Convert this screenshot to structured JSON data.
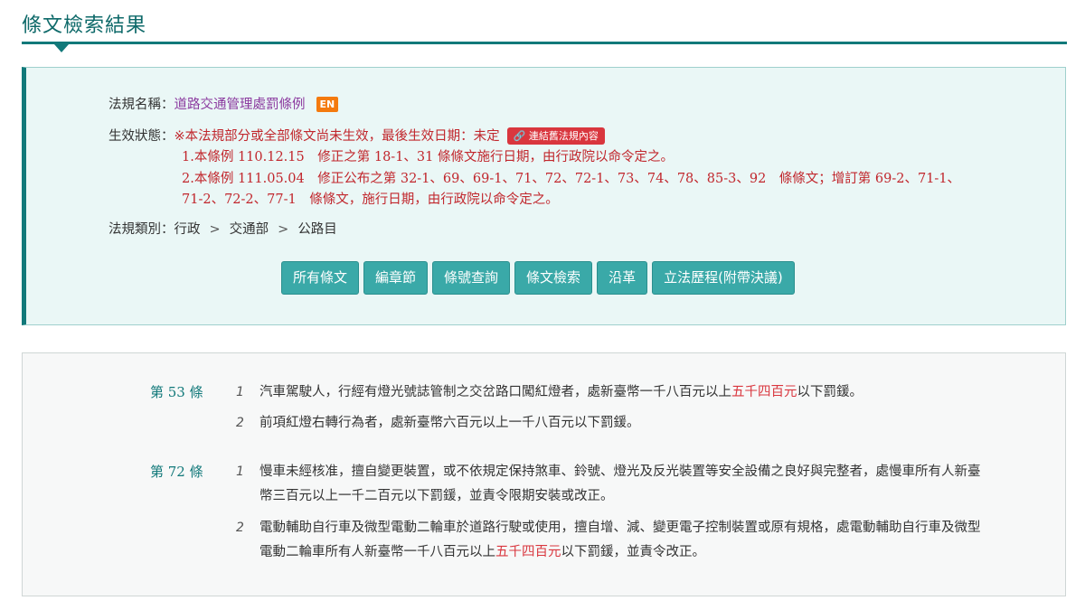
{
  "header": {
    "title": "條文檢索結果"
  },
  "info": {
    "name_label": "法規名稱：",
    "law_name": "道路交通管理處罰條例",
    "en_badge": "EN",
    "status_label": "生效狀態：",
    "status_text": "※本法規部分或全部條文尚未生效，最後生效日期：未定",
    "old_link_label": "🔗 連結舊法規內容",
    "status_note_1": "1.本條例 110.12.15　修正之第 18-1、31 條條文施行日期，由行政院以命令定之。",
    "status_note_2": "2.本條例 111.05.04　修正公布之第 32-1、69、69-1、71、72、72-1、73、74、78、85-3、92　條條文；增訂第 69-2、71-1、71-2、72-2、77-1　條條文，施行日期，由行政院以命令定之。",
    "category_label": "法規類別：",
    "category_path": [
      "行政",
      "交通部",
      "公路目"
    ],
    "category_sep": ">"
  },
  "buttons": [
    "所有條文",
    "編章節",
    "條號查詢",
    "條文檢索",
    "沿革",
    "立法歷程(附帶決議)"
  ],
  "articles": [
    {
      "number": "第 53 條",
      "paragraphs": [
        {
          "idx": "1",
          "before": "汽車駕駛人，行經有燈光號誌管制之交岔路口闖紅燈者，處新臺幣一千八百元以上",
          "highlight": "五千四百元",
          "after": "以下罰鍰。"
        },
        {
          "idx": "2",
          "before": "前項紅燈右轉行為者，處新臺幣六百元以上一千八百元以下罰鍰。",
          "highlight": "",
          "after": ""
        }
      ]
    },
    {
      "number": "第 72 條",
      "paragraphs": [
        {
          "idx": "1",
          "before": "慢車未經核准，擅自變更裝置，或不依規定保持煞車、鈴號、燈光及反光裝置等安全設備之良好與完整者，處慢車所有人新臺幣三百元以上一千二百元以下罰鍰，並責令限期安裝或改正。",
          "highlight": "",
          "after": ""
        },
        {
          "idx": "2",
          "before": "電動輔助自行車及微型電動二輪車於道路行駛或使用，擅自增、減、變更電子控制裝置或原有規格，處電動輔助自行車及微型電動二輪車所有人新臺幣一千八百元以上",
          "highlight": "五千四百元",
          "after": "以下罰鍰，並責令改正。"
        }
      ]
    }
  ],
  "colors": {
    "accent": "#12797a",
    "button": "#3aa9a8",
    "status_red": "#c1272d",
    "highlight_red": "#d9363e",
    "law_link": "#8b3a9f",
    "en_badge": "#f47a0e"
  }
}
